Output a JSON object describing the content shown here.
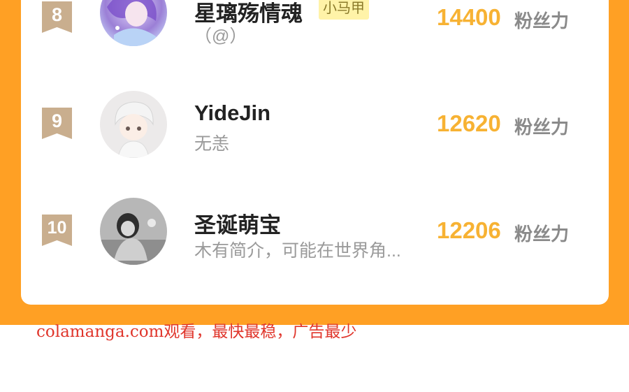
{
  "leaderboard": {
    "unit_label": "粉丝力",
    "entries": [
      {
        "rank": "8",
        "name": "星璃殇情魂",
        "tag": "小马甲",
        "bio": "（@）",
        "score": "14400",
        "avatar": "purple-haired-anime-avatar"
      },
      {
        "rank": "9",
        "name": "YideJin",
        "bio": "无恙",
        "score": "12620",
        "avatar": "white-haired-chibi-avatar"
      },
      {
        "rank": "10",
        "name": "圣诞萌宝",
        "bio": "木有简介，可能在世界角...",
        "score": "12206",
        "avatar": "grayscale-child-photo-avatar"
      }
    ]
  },
  "watermark": {
    "text": "colamanga.com观看，最快最稳，广告最少"
  },
  "colors": {
    "accent": "#FFA024",
    "score": "#F7B233",
    "badge": "#C9AE8E",
    "watermark": "#E0362C"
  }
}
